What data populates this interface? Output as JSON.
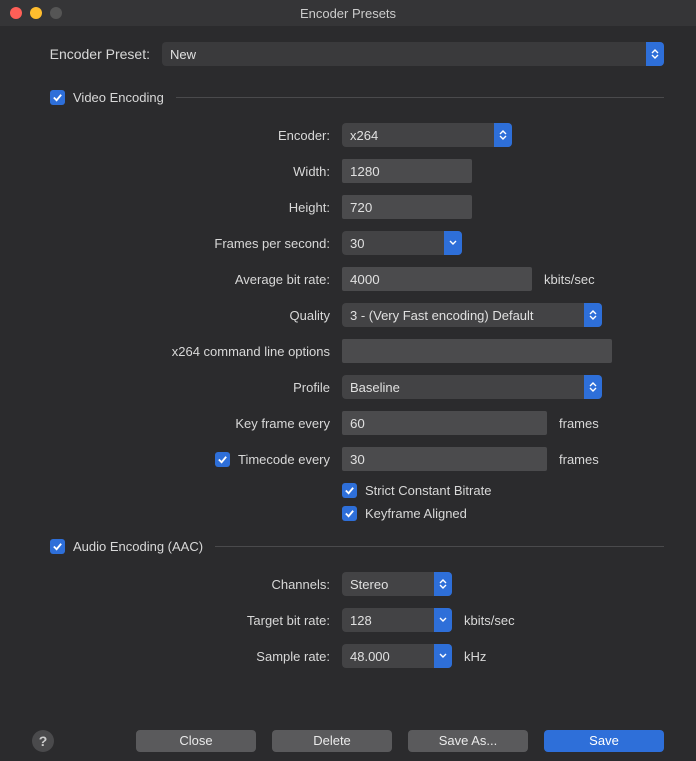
{
  "window": {
    "title": "Encoder Presets"
  },
  "preset": {
    "label": "Encoder Preset:",
    "value": "New"
  },
  "video": {
    "section": "Video Encoding",
    "encoder_label": "Encoder:",
    "encoder_value": "x264",
    "width_label": "Width:",
    "width_value": "1280",
    "height_label": "Height:",
    "height_value": "720",
    "fps_label": "Frames per second:",
    "fps_value": "30",
    "abr_label": "Average bit rate:",
    "abr_value": "4000",
    "abr_suffix": "kbits/sec",
    "quality_label": "Quality",
    "quality_value": "3 - (Very Fast encoding) Default",
    "cmdline_label": "x264 command line options",
    "cmdline_value": "",
    "profile_label": "Profile",
    "profile_value": "Baseline",
    "keyframe_label": "Key frame every",
    "keyframe_value": "60",
    "keyframe_suffix": "frames",
    "timecode_label": "Timecode every",
    "timecode_value": "30",
    "timecode_suffix": "frames",
    "scbr_label": "Strict Constant Bitrate",
    "kfa_label": "Keyframe Aligned"
  },
  "audio": {
    "section": "Audio Encoding (AAC)",
    "channels_label": "Channels:",
    "channels_value": "Stereo",
    "tbr_label": "Target bit rate:",
    "tbr_value": "128",
    "tbr_suffix": "kbits/sec",
    "sr_label": "Sample rate:",
    "sr_value": "48.000",
    "sr_suffix": "kHz"
  },
  "buttons": {
    "close": "Close",
    "delete": "Delete",
    "saveas": "Save As...",
    "save": "Save"
  }
}
